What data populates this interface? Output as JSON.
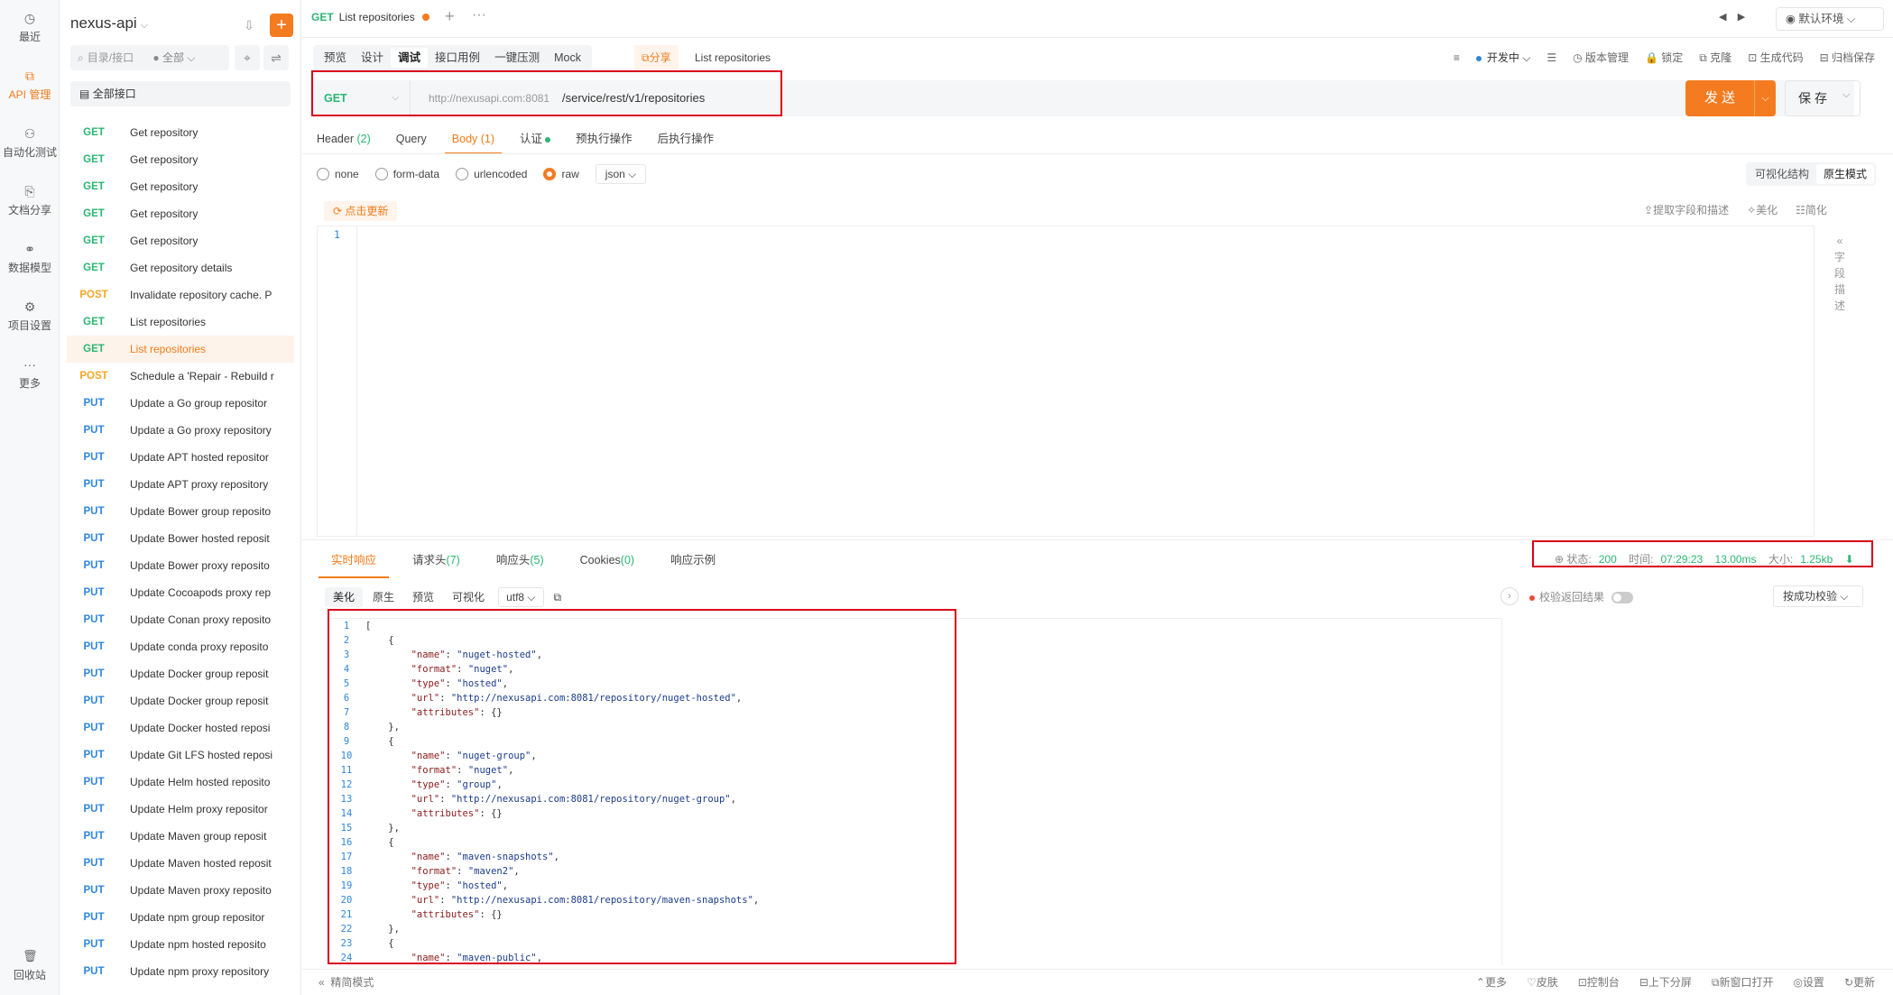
{
  "rail": {
    "items": [
      {
        "label": "最近",
        "icon": "clock-icon"
      },
      {
        "label": "API 管理",
        "icon": "api-icon",
        "active": true
      },
      {
        "label": "自动化测试",
        "icon": "test-icon"
      },
      {
        "label": "文档分享",
        "icon": "doc-share-icon"
      },
      {
        "label": "数据模型",
        "icon": "data-model-icon"
      },
      {
        "label": "项目设置",
        "icon": "settings-icon"
      },
      {
        "label": "更多",
        "icon": "more-icon"
      }
    ],
    "trash": "回收站"
  },
  "sidebar": {
    "project": "nexus-api",
    "search_placeholder": "目录/接口",
    "filter": "全部",
    "all_apis": "全部接口",
    "apis": [
      {
        "method": "GET",
        "name": "Get repository"
      },
      {
        "method": "GET",
        "name": "Get repository"
      },
      {
        "method": "GET",
        "name": "Get repository"
      },
      {
        "method": "GET",
        "name": "Get repository"
      },
      {
        "method": "GET",
        "name": "Get repository"
      },
      {
        "method": "GET",
        "name": "Get repository details"
      },
      {
        "method": "POST",
        "name": "Invalidate repository cache. P"
      },
      {
        "method": "GET",
        "name": "List repositories"
      },
      {
        "method": "GET",
        "name": "List repositories",
        "active": true
      },
      {
        "method": "POST",
        "name": "Schedule a 'Repair - Rebuild r"
      },
      {
        "method": "PUT",
        "name": "Update a Go group repositor"
      },
      {
        "method": "PUT",
        "name": "Update a Go proxy repository"
      },
      {
        "method": "PUT",
        "name": "Update APT hosted repositor"
      },
      {
        "method": "PUT",
        "name": "Update APT proxy repository"
      },
      {
        "method": "PUT",
        "name": "Update Bower group reposito"
      },
      {
        "method": "PUT",
        "name": "Update Bower hosted reposit"
      },
      {
        "method": "PUT",
        "name": "Update Bower proxy reposito"
      },
      {
        "method": "PUT",
        "name": "Update Cocoapods proxy rep"
      },
      {
        "method": "PUT",
        "name": "Update Conan proxy reposito"
      },
      {
        "method": "PUT",
        "name": "Update conda proxy reposito"
      },
      {
        "method": "PUT",
        "name": "Update Docker group reposit"
      },
      {
        "method": "PUT",
        "name": "Update Docker group reposit"
      },
      {
        "method": "PUT",
        "name": "Update Docker hosted reposi"
      },
      {
        "method": "PUT",
        "name": "Update Git LFS hosted reposi"
      },
      {
        "method": "PUT",
        "name": "Update Helm hosted reposito"
      },
      {
        "method": "PUT",
        "name": "Update Helm proxy repositor"
      },
      {
        "method": "PUT",
        "name": "Update Maven group reposit"
      },
      {
        "method": "PUT",
        "name": "Update Maven hosted reposit"
      },
      {
        "method": "PUT",
        "name": "Update Maven proxy reposito"
      },
      {
        "method": "PUT",
        "name": "Update npm group repositor"
      },
      {
        "method": "PUT",
        "name": "Update npm hosted reposito"
      },
      {
        "method": "PUT",
        "name": "Update npm proxy repository"
      }
    ]
  },
  "tab": {
    "method": "GET",
    "title": "List repositories"
  },
  "env": "默认环境",
  "toolbar": {
    "segments": [
      "预览",
      "设计",
      "调试",
      "接口用例",
      "一键压测",
      "Mock"
    ],
    "active_segment": "调试",
    "share": "分享",
    "api_title": "List repositories",
    "status": "开发中",
    "tools": [
      "版本管理",
      "锁定",
      "克隆",
      "生成代码",
      "归档保存"
    ]
  },
  "request": {
    "method": "GET",
    "host": "http://nexusapi.com:8081",
    "path": "/service/rest/v1/repositories",
    "send": "发送",
    "save": "保存"
  },
  "req_tabs": [
    {
      "label": "Header",
      "count": "(2)"
    },
    {
      "label": "Query",
      "count": ""
    },
    {
      "label": "Body",
      "count": "(1)",
      "active": true
    },
    {
      "label": "认证",
      "count": ""
    },
    {
      "label": "预执行操作",
      "count": ""
    },
    {
      "label": "后执行操作",
      "count": ""
    }
  ],
  "body_types": [
    "none",
    "form-data",
    "urlencoded",
    "raw"
  ],
  "body_format": "json",
  "modes": [
    "可视化结构",
    "原生模式"
  ],
  "refresh": "点击更新",
  "editor_tools": [
    "提取字段和描述",
    "美化",
    "简化"
  ],
  "side_desc": "字段描述",
  "editor_line": "1",
  "resp_tabs": [
    {
      "label": "实时响应",
      "count": "",
      "active": true
    },
    {
      "label": "请求头",
      "count": "(7)"
    },
    {
      "label": "响应头",
      "count": "(5)"
    },
    {
      "label": "Cookies",
      "count": "(0)"
    },
    {
      "label": "响应示例",
      "count": ""
    }
  ],
  "status": {
    "label_status": "状态:",
    "code": "200",
    "label_time": "时间:",
    "time": "07:29:23",
    "duration": "13.00ms",
    "label_size": "大小:",
    "size": "1.25kb"
  },
  "resp_tool": [
    "美化",
    "原生",
    "预览",
    "可视化"
  ],
  "encoding": "utf8",
  "validate": "校验返回结果",
  "success_check": "按成功校验",
  "response_lines": [
    {
      "n": "1",
      "indent": 0,
      "text": "["
    },
    {
      "n": "2",
      "indent": 1,
      "text": "{"
    },
    {
      "n": "3",
      "indent": 2,
      "key": "name",
      "val": "nuget-hosted"
    },
    {
      "n": "4",
      "indent": 2,
      "key": "format",
      "val": "nuget"
    },
    {
      "n": "5",
      "indent": 2,
      "key": "type",
      "val": "hosted"
    },
    {
      "n": "6",
      "indent": 2,
      "key": "url",
      "val": "http://nexusapi.com:8081/repository/nuget-hosted"
    },
    {
      "n": "7",
      "indent": 2,
      "key": "attributes",
      "raw": "{}"
    },
    {
      "n": "8",
      "indent": 1,
      "text": "},"
    },
    {
      "n": "9",
      "indent": 1,
      "text": "{"
    },
    {
      "n": "10",
      "indent": 2,
      "key": "name",
      "val": "nuget-group"
    },
    {
      "n": "11",
      "indent": 2,
      "key": "format",
      "val": "nuget"
    },
    {
      "n": "12",
      "indent": 2,
      "key": "type",
      "val": "group"
    },
    {
      "n": "13",
      "indent": 2,
      "key": "url",
      "val": "http://nexusapi.com:8081/repository/nuget-group"
    },
    {
      "n": "14",
      "indent": 2,
      "key": "attributes",
      "raw": "{}"
    },
    {
      "n": "15",
      "indent": 1,
      "text": "},"
    },
    {
      "n": "16",
      "indent": 1,
      "text": "{"
    },
    {
      "n": "17",
      "indent": 2,
      "key": "name",
      "val": "maven-snapshots"
    },
    {
      "n": "18",
      "indent": 2,
      "key": "format",
      "val": "maven2"
    },
    {
      "n": "19",
      "indent": 2,
      "key": "type",
      "val": "hosted"
    },
    {
      "n": "20",
      "indent": 2,
      "key": "url",
      "val": "http://nexusapi.com:8081/repository/maven-snapshots"
    },
    {
      "n": "21",
      "indent": 2,
      "key": "attributes",
      "raw": "{}"
    },
    {
      "n": "22",
      "indent": 1,
      "text": "},"
    },
    {
      "n": "23",
      "indent": 1,
      "text": "{"
    },
    {
      "n": "24",
      "indent": 2,
      "key": "name",
      "val": "maven-public"
    }
  ],
  "footer": {
    "left": "精简模式",
    "right": [
      "更多",
      "皮肤",
      "控制台",
      "上下分屏",
      "新窗口打开",
      "设置",
      "更新"
    ]
  }
}
